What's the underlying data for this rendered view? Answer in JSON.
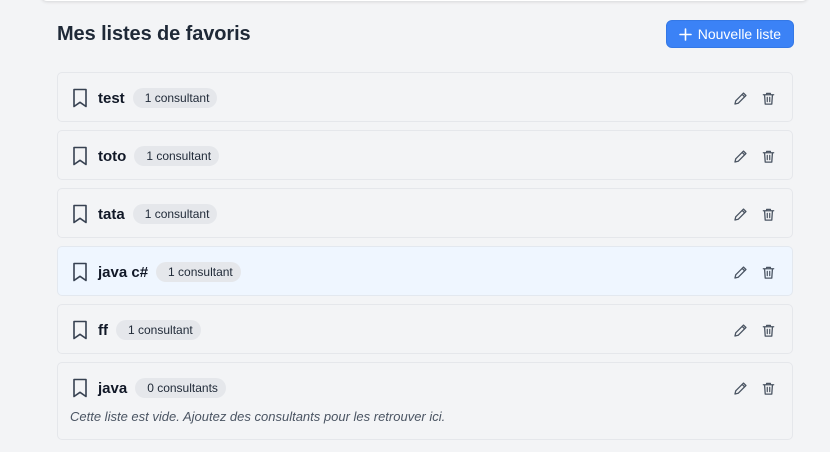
{
  "header": {
    "title": "Mes listes de favoris",
    "new_button_label": "Nouvelle liste"
  },
  "lists": [
    {
      "name": "test",
      "badge": "1 consultant"
    },
    {
      "name": "toto",
      "badge": "1 consultant"
    },
    {
      "name": "tata",
      "badge": "1 consultant"
    },
    {
      "name": "java c#",
      "badge": "1 consultant"
    },
    {
      "name": "ff",
      "badge": "1 consultant"
    },
    {
      "name": "java",
      "badge": "0 consultants",
      "empty_message": "Cette liste est vide. Ajoutez des consultants pour les retrouver ici."
    }
  ],
  "icons": {
    "bookmark": "bookmark-icon",
    "edit": "pencil-icon",
    "delete": "trash-icon",
    "add": "plus-icon"
  },
  "colors": {
    "accent": "#3b82f6",
    "highlight_row": "#eff6ff"
  }
}
